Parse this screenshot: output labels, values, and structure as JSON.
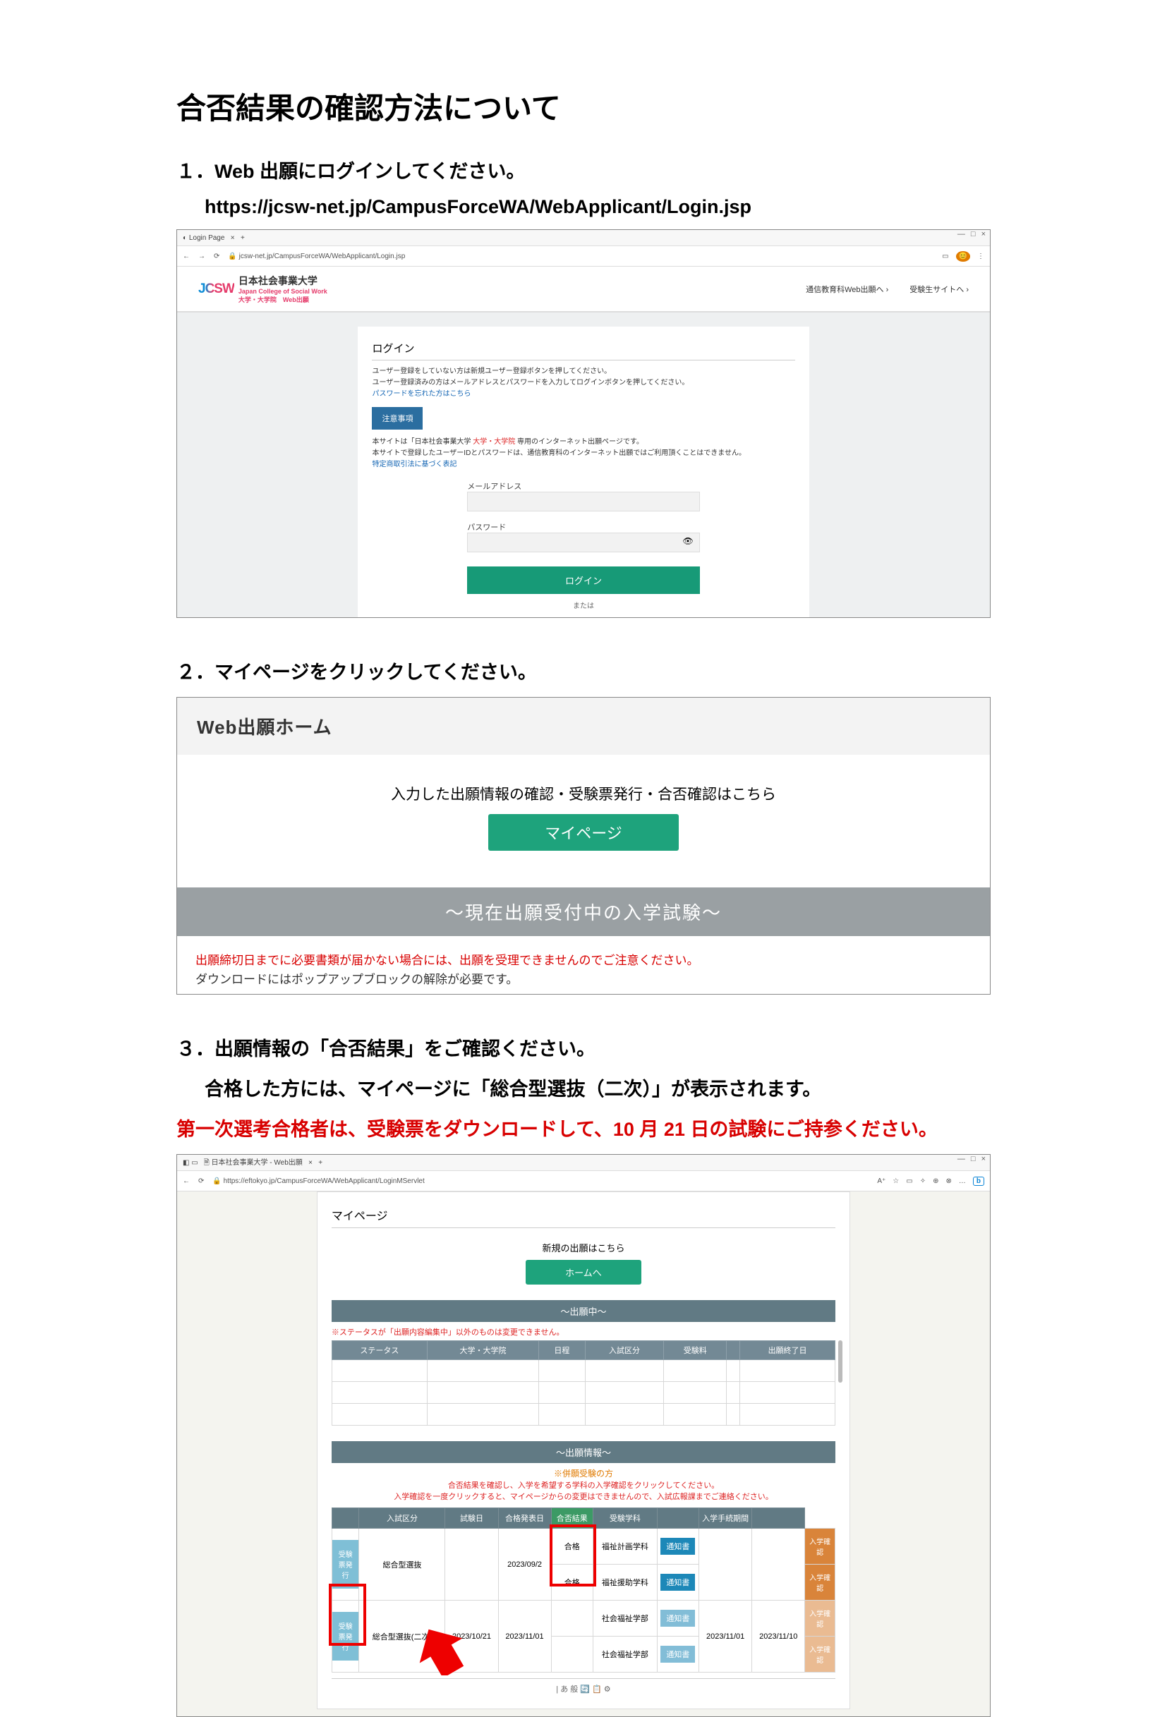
{
  "doc": {
    "title": "合否結果の確認方法について",
    "step1_h": "１．Web 出願にログインしてください。",
    "url": "https://jcsw-net.jp/CampusForceWA/WebApplicant/Login.jsp",
    "step2_h": "２．マイページをクリックしてください。",
    "step3_h": "３．出願情報の「合否結果」をご確認ください。",
    "step3_line2": "合格した方には、マイページに「総合型選抜（二次）」が表示されます。",
    "step3_red": "第一次選考合格者は、受験票をダウンロードして、10 月 21 日の試験にご持参ください。"
  },
  "s1": {
    "tab": "Login Page",
    "addr": "jcsw-net.jp/CampusForceWA/WebApplicant/Login.jsp",
    "uname": "日本社会事業大学",
    "usub1": "Japan College of Social Work",
    "usub2": "大学・大学院　Web出願",
    "link1": "通信教育科Web出願へ",
    "link2": "受験生サイトへ",
    "card_title": "ログイン",
    "msg1": "ユーザー登録をしていない方は新規ユーザー登録ボタンを押してください。",
    "msg2": "ユーザー登録済みの方はメールアドレスとパスワードを入力してログインボタンを押してください。",
    "pwlink": "パスワードを忘れた方はこちら",
    "notice_btn": "注意事項",
    "notice1a": "本サイトは「日本社会事業大学 ",
    "notice1b": "大学・大学院",
    "notice1c": " 専用のインターネット出願ページです。",
    "notice2": "本サイトで登録したユーザーIDとパスワードは、通信教育科のインターネット出願ではご利用頂くことはできません。",
    "notice3": "特定商取引法に基づく表記",
    "f_email": "メールアドレス",
    "f_pass": "パスワード",
    "login_btn": "ログイン",
    "or": "または"
  },
  "s2": {
    "head": "Web出願ホーム",
    "msg": "入力した出願情報の確認・受験票発行・合否確認はこちら",
    "mybtn": "マイページ",
    "bar": "～現在出願受付中の入学試験～",
    "warn": "出願締切日までに必要書類が届かない場合には、出願を受理できませんのでご注意ください。",
    "note": "ダウンロードにはポップアップブロックの解除が必要です。"
  },
  "s3": {
    "tab": "日本社会事業大学 - Web出願",
    "addr": "https://eftokyo.jp/CampusForceWA/WebApplicant/LoginMServlet",
    "title": "マイページ",
    "cta": "新規の出願はこちら",
    "home": "ホームへ",
    "bar1": "～出願中～",
    "note1": "※ステータスが「出願内容編集中」以外のものは変更できません。",
    "t1_h": [
      "ステータス",
      "大学・大学院",
      "日程",
      "入試区分",
      "受験料",
      "",
      "出願終了日"
    ],
    "bar2": "～出願情報～",
    "orange": "※併願受験の方",
    "red_a": "合否結果を確認し、入学を希望する学科の入学確認をクリックしてください。",
    "red_b": "入学確認を一度クリックすると、マイページからの変更はできませんので、入試広報課までご連絡ください。",
    "t2_h": [
      "",
      "入試区分",
      "試験日",
      "合格発表日",
      "合否結果",
      "受験学科",
      "",
      "入学手続期間",
      ""
    ],
    "rows": [
      {
        "btn": "受験票発行",
        "type": "総合型選抜",
        "exam": "",
        "ann": "2023/09/2",
        "res": [
          "合格",
          "合格"
        ],
        "dept": [
          "福祉計画学科",
          "福祉援助学科"
        ],
        "notice": [
          "通知書",
          "通知書"
        ],
        "period": [
          "",
          ""
        ],
        "act": [
          "入学確認",
          "入学確認"
        ]
      },
      {
        "btn": "受験票発行",
        "type": "総合型選抜(二次)",
        "exam": "2023/10/21",
        "ann": "2023/11/01",
        "res": [
          "",
          ""
        ],
        "dept": [
          "社会福祉学部",
          "社会福祉学部"
        ],
        "notice": [
          "通知書",
          "通知書"
        ],
        "period": [
          "2023/11/01",
          "2023/11/10"
        ],
        "act": [
          "入学確認",
          "入学確認"
        ]
      }
    ],
    "ime": "| あ 般 🔄 📋 ⚙"
  }
}
